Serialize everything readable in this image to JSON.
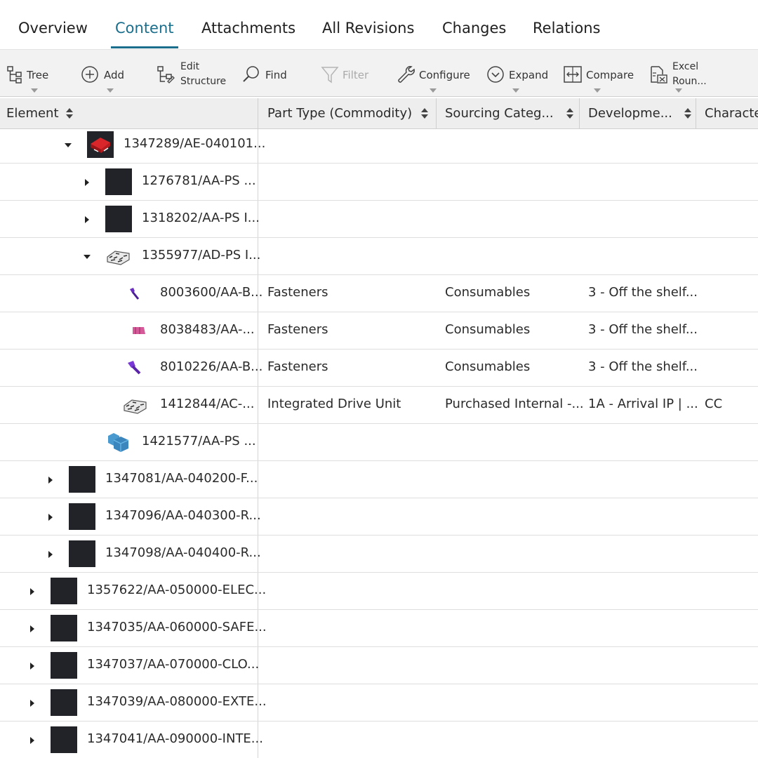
{
  "tabs": [
    {
      "label": "Overview",
      "active": false
    },
    {
      "label": "Content",
      "active": true
    },
    {
      "label": "Attachments",
      "active": false
    },
    {
      "label": "All Revisions",
      "active": false
    },
    {
      "label": "Changes",
      "active": false
    },
    {
      "label": "Relations",
      "active": false
    }
  ],
  "toolbar": {
    "tree": "Tree",
    "add": "Add",
    "edit_structure_1": "Edit",
    "edit_structure_2": "Structure",
    "find": "Find",
    "filter": "Filter",
    "configure": "Configure",
    "expand": "Expand",
    "compare": "Compare",
    "excel_1": "Excel",
    "excel_2": "Roun..."
  },
  "columns": [
    "Element",
    "Part Type (Commodity)",
    "Sourcing Categ...",
    "Developme...",
    "Characte"
  ],
  "rows": [
    {
      "element": "1347289/AE-040101...",
      "part_type": "",
      "sourcing": "",
      "development": "",
      "character": ""
    },
    {
      "element": "1276781/AA-PS ...",
      "part_type": "",
      "sourcing": "",
      "development": "",
      "character": ""
    },
    {
      "element": "1318202/AA-PS I...",
      "part_type": "",
      "sourcing": "",
      "development": "",
      "character": ""
    },
    {
      "element": "1355977/AD-PS I...",
      "part_type": "",
      "sourcing": "",
      "development": "",
      "character": ""
    },
    {
      "element": "8003600/AA-B...",
      "part_type": "Fasteners",
      "sourcing": "Consumables",
      "development": "3 - Off the shelf...",
      "character": ""
    },
    {
      "element": "8038483/AA-...",
      "part_type": "Fasteners",
      "sourcing": "Consumables",
      "development": "3 - Off the shelf...",
      "character": ""
    },
    {
      "element": "8010226/AA-B...",
      "part_type": "Fasteners",
      "sourcing": "Consumables",
      "development": "3 - Off the shelf...",
      "character": ""
    },
    {
      "element": "1412844/AC-...",
      "part_type": "Integrated Drive Unit",
      "sourcing": "Purchased Internal -...",
      "development": "1A - Arrival IP | ...",
      "character": "CC"
    },
    {
      "element": "1421577/AA-PS ...",
      "part_type": "",
      "sourcing": "",
      "development": "",
      "character": ""
    },
    {
      "element": "1347081/AA-040200-F...",
      "part_type": "",
      "sourcing": "",
      "development": "",
      "character": ""
    },
    {
      "element": "1347096/AA-040300-R...",
      "part_type": "",
      "sourcing": "",
      "development": "",
      "character": ""
    },
    {
      "element": "1347098/AA-040400-R...",
      "part_type": "",
      "sourcing": "",
      "development": "",
      "character": ""
    },
    {
      "element": "1357622/AA-050000-ELEC...",
      "part_type": "",
      "sourcing": "",
      "development": "",
      "character": ""
    },
    {
      "element": "1347035/AA-060000-SAFE...",
      "part_type": "",
      "sourcing": "",
      "development": "",
      "character": ""
    },
    {
      "element": "1347037/AA-070000-CLO...",
      "part_type": "",
      "sourcing": "",
      "development": "",
      "character": ""
    },
    {
      "element": "1347039/AA-080000-EXTE...",
      "part_type": "",
      "sourcing": "",
      "development": "",
      "character": ""
    },
    {
      "element": "1347041/AA-090000-INTE...",
      "part_type": "",
      "sourcing": "",
      "development": "",
      "character": ""
    }
  ],
  "colors": {
    "accent": "#1b6f8c",
    "disabled": "#aaaaaa"
  }
}
